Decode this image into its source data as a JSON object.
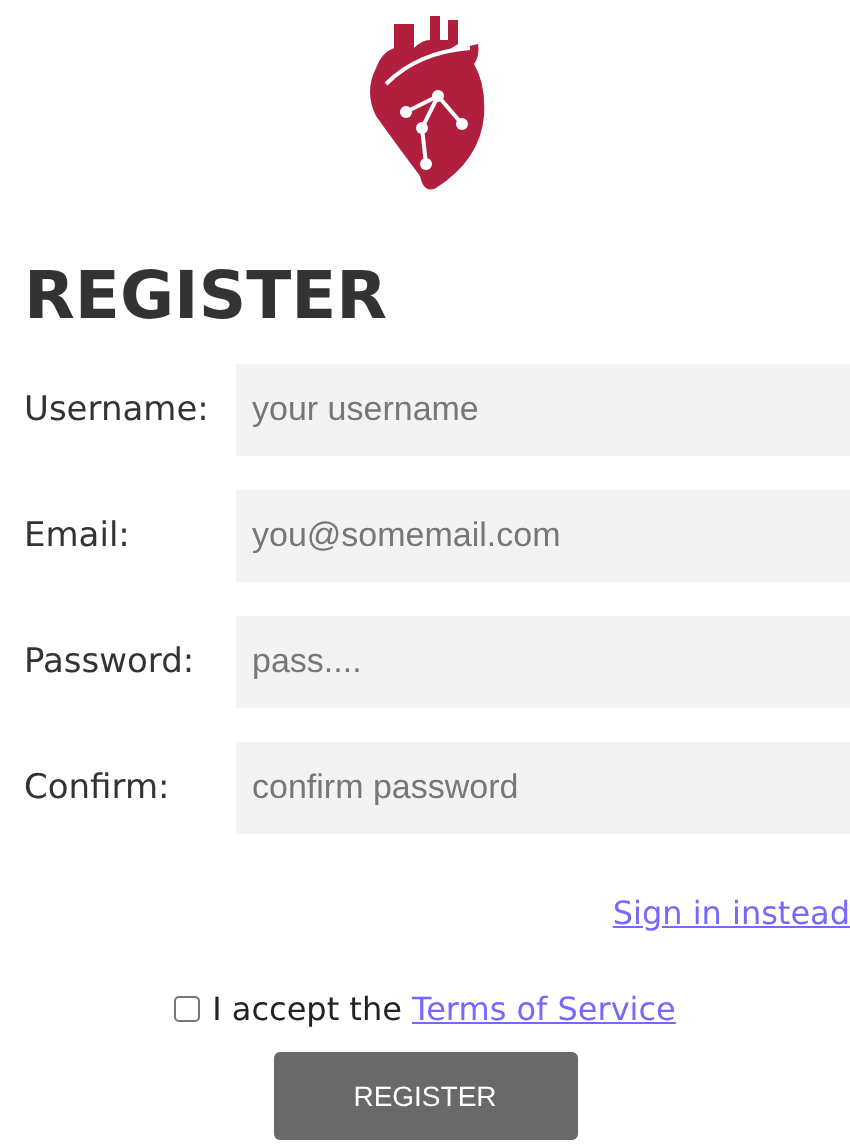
{
  "title": "REGISTER",
  "fields": [
    {
      "label": "Username:",
      "placeholder": "your username"
    },
    {
      "label": "Email:",
      "placeholder": "you@somemail.com"
    },
    {
      "label": "Password:",
      "placeholder": "pass...."
    },
    {
      "label": "Confirm:",
      "placeholder": "confirm password"
    }
  ],
  "sign_in_link": "Sign in instead",
  "terms": {
    "text": "I accept the",
    "link": "Terms of Service",
    "checked": false
  },
  "submit_button": "REGISTER"
}
